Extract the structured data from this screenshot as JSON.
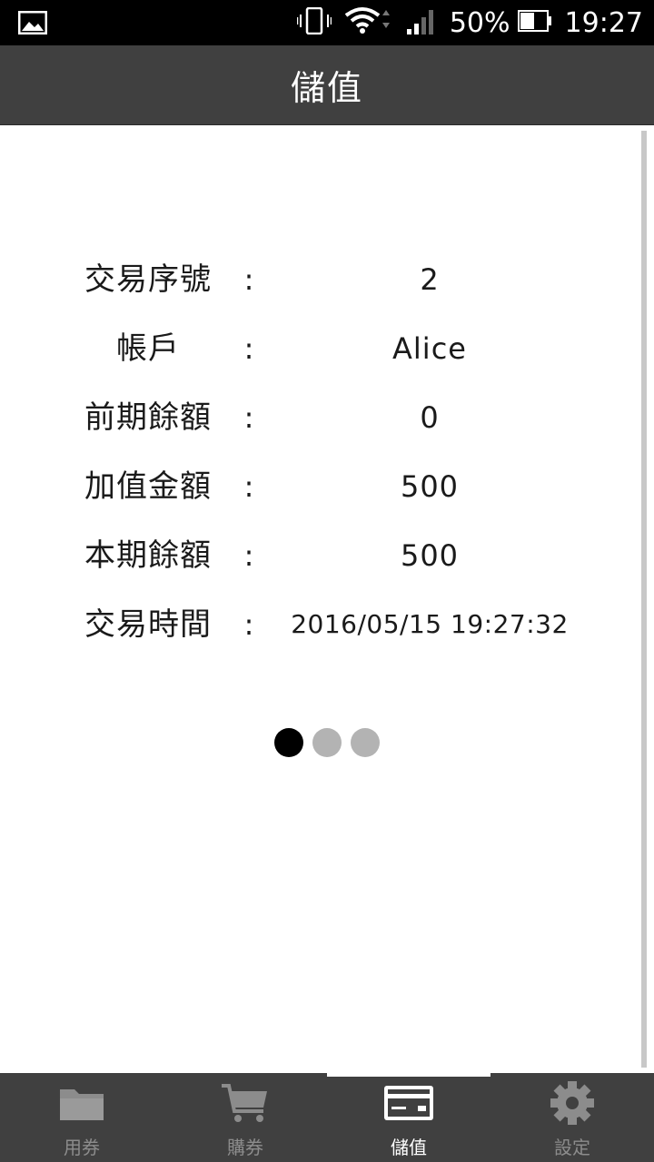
{
  "status_bar": {
    "battery": "50%",
    "time": "19:27"
  },
  "header": {
    "title": "儲值"
  },
  "details": [
    {
      "label": "交易序號",
      "colon": ":",
      "value": "2"
    },
    {
      "label": "帳戶",
      "colon": ":",
      "value": "Alice"
    },
    {
      "label": "前期餘額",
      "colon": ":",
      "value": "0"
    },
    {
      "label": "加值金額",
      "colon": ":",
      "value": "500"
    },
    {
      "label": "本期餘額",
      "colon": ":",
      "value": "500"
    },
    {
      "label": "交易時間",
      "colon": ":",
      "value": "2016/05/15 19:27:32"
    }
  ],
  "pager": {
    "count": 3,
    "active_index": 0
  },
  "bottom_nav": {
    "tabs": [
      {
        "label": "用券",
        "icon": "folder-icon"
      },
      {
        "label": "購券",
        "icon": "cart-icon"
      },
      {
        "label": "儲值",
        "icon": "credit-card-icon",
        "active": true
      },
      {
        "label": "設定",
        "icon": "gear-icon"
      }
    ]
  },
  "colors": {
    "bar": "#404040",
    "active": "#ffffff",
    "inactive": "#8c8c8c",
    "text": "#1a1a1a"
  }
}
